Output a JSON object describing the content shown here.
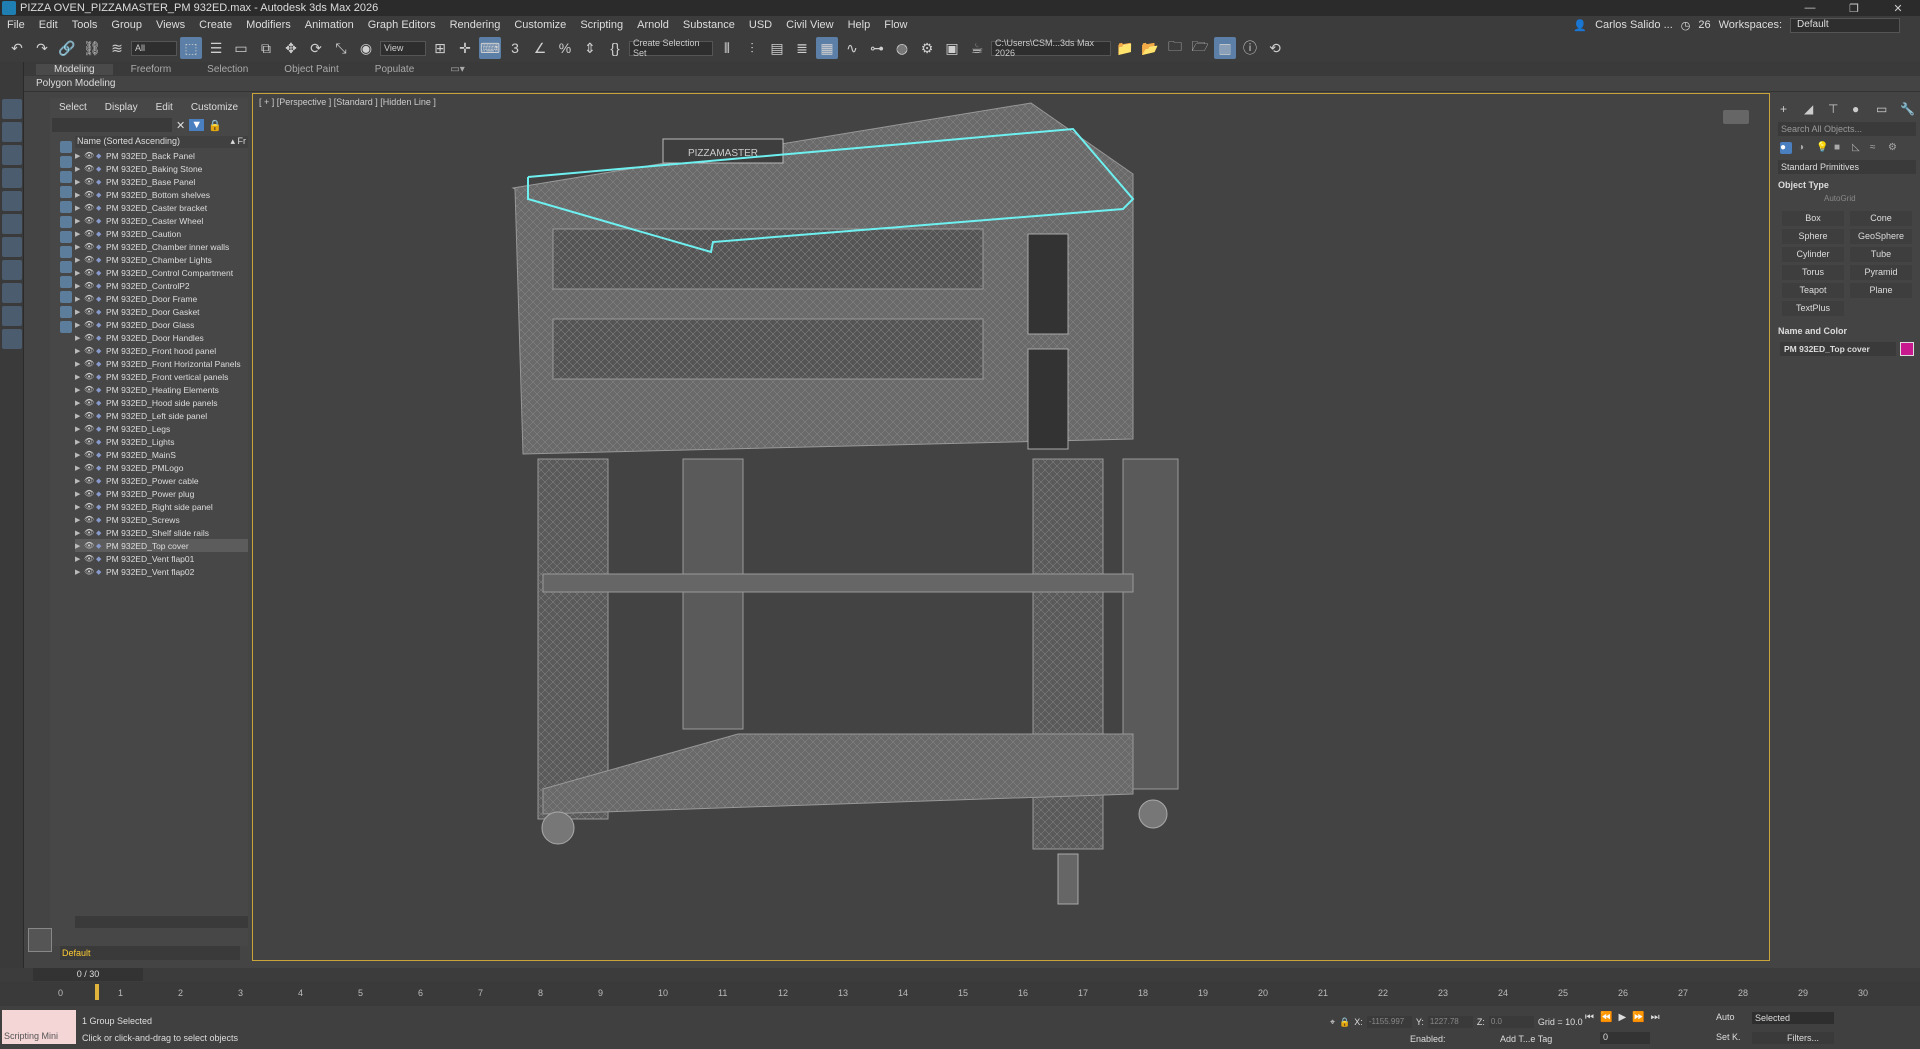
{
  "window": {
    "title": "PIZZA OVEN_PIZZAMASTER_PM 932ED.max - Autodesk 3ds Max 2026"
  },
  "menu": [
    "File",
    "Edit",
    "Tools",
    "Group",
    "Views",
    "Create",
    "Modifiers",
    "Animation",
    "Graph Editors",
    "Rendering",
    "Customize",
    "Scripting",
    "Arnold",
    "Substance",
    "USD",
    "Civil View",
    "Help",
    "Flow"
  ],
  "user": {
    "name": "Carlos Salido ...",
    "count": "26",
    "workspaces_label": "Workspaces:",
    "workspace": "Default"
  },
  "toolbar": {
    "filter": "All",
    "refcoord": "View",
    "selection_set": "Create Selection Set",
    "path": "C:\\Users\\CSM...3ds Max 2026"
  },
  "ribbon": {
    "tabs": [
      "Modeling",
      "Freeform",
      "Selection",
      "Object Paint",
      "Populate"
    ],
    "active": "Modeling",
    "sub": "Polygon Modeling"
  },
  "explorer": {
    "menu": [
      "Select",
      "Display",
      "Edit",
      "Customize"
    ],
    "header": "Name (Sorted Ascending)",
    "header_right": "▴ Fr",
    "items": [
      "PM 932ED_Back Panel",
      "PM 932ED_Baking Stone",
      "PM 932ED_Base Panel",
      "PM 932ED_Bottom shelves",
      "PM 932ED_Caster bracket",
      "PM 932ED_Caster Wheel",
      "PM 932ED_Caution",
      "PM 932ED_Chamber inner walls",
      "PM 932ED_Chamber Lights",
      "PM 932ED_Control Compartment",
      "PM 932ED_ControlP2",
      "PM 932ED_Door Frame",
      "PM 932ED_Door Gasket",
      "PM 932ED_Door Glass",
      "PM 932ED_Door Handles",
      "PM 932ED_Front hood panel",
      "PM 932ED_Front Horizontal Panels",
      "PM 932ED_Front vertical panels",
      "PM 932ED_Heating Elements",
      "PM 932ED_Hood side panels",
      "PM 932ED_Left side panel",
      "PM 932ED_Legs",
      "PM 932ED_Lights",
      "PM 932ED_MainS",
      "PM 932ED_PMLogo",
      "PM 932ED_Power cable",
      "PM 932ED_Power plug",
      "PM 932ED_Right side panel",
      "PM 932ED_Screws",
      "PM 932ED_Shelf slide rails",
      "PM 932ED_Top cover",
      "PM 932ED_Vent flap01",
      "PM 932ED_Vent flap02"
    ],
    "selected": "PM 932ED_Top cover",
    "layer": "Default"
  },
  "viewport": {
    "label": "[ + ] [Perspective ] [Standard ] [Hidden Line ]",
    "oven_logo": "PIZZAMASTER"
  },
  "command_panel": {
    "search_placeholder": "Search All Objects...",
    "category": "Standard Primitives",
    "object_type": "Object Type",
    "autogrid": "AutoGrid",
    "primitives": [
      "Box",
      "Cone",
      "Sphere",
      "GeoSphere",
      "Cylinder",
      "Tube",
      "Torus",
      "Pyramid",
      "Teapot",
      "Plane",
      "TextPlus"
    ],
    "name_and_color": "Name and Color",
    "object_name": "PM 932ED_Top cover",
    "object_color": "#c9198e"
  },
  "timeline": {
    "frame": "0 / 30",
    "ticks": [
      "0",
      "1",
      "2",
      "3",
      "4",
      "5",
      "6",
      "7",
      "8",
      "9",
      "10",
      "11",
      "12",
      "13",
      "14",
      "15",
      "16",
      "17",
      "18",
      "19",
      "20",
      "21",
      "22",
      "23",
      "24",
      "25",
      "26",
      "27",
      "28",
      "29",
      "30"
    ]
  },
  "status": {
    "script": "Scripting Mini",
    "selection": "1 Group Selected",
    "hint": "Click or click-and-drag to select objects",
    "x_label": "X:",
    "x": "-1155.997",
    "y_label": "Y:",
    "y": "1227.78",
    "z_label": "Z:",
    "z": "0.0",
    "grid": "Grid = 10.0",
    "enabled": "Enabled:",
    "add_tag": "Add T...e Tag",
    "auto": "Auto",
    "setk": "Set K.",
    "sel_filter": "Selected",
    "filters": "Filters...",
    "frame_field": "0"
  }
}
